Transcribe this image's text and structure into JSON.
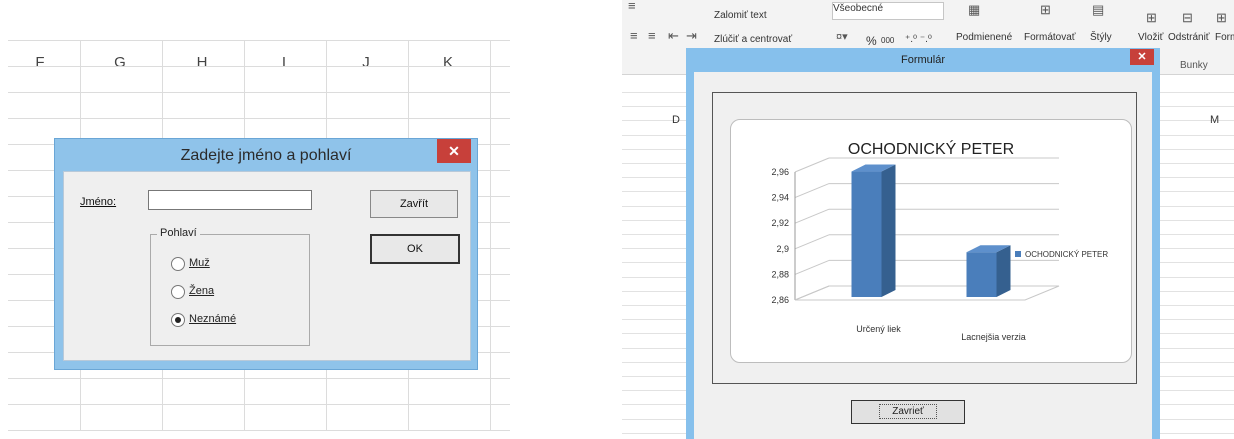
{
  "left": {
    "columns": [
      "F",
      "G",
      "H",
      "I",
      "J",
      "K"
    ],
    "dialog": {
      "title": "Zadejte jméno a pohlaví",
      "close_glyph": "✕",
      "name_label": "Jméno:",
      "name_value": "",
      "close_button": "Zavřít",
      "ok_button": "OK",
      "gender_frame": "Pohlaví",
      "options": [
        "Muž",
        "Žena",
        "Neznámé"
      ],
      "selected_option": "Neznámé"
    }
  },
  "right": {
    "ribbon": {
      "wrap_text": "Zalomiť text",
      "number_format": "Všeobecné",
      "merge_center": "Zlúčiť a centrovať",
      "percent": "%",
      "thousands": "000",
      "cond_format": "Podmienené",
      "format_as": "Formátovať",
      "styles": "Štýly",
      "insert": "Vložiť",
      "delete": "Odstrániť",
      "format": "Form",
      "cells_group": "Bunky"
    },
    "columns": [
      "D",
      "M"
    ],
    "dialog": {
      "title": "Formulár",
      "close_glyph": "✕",
      "close_button": "Zavrieť"
    }
  },
  "chart_data": {
    "type": "bar",
    "title": "OCHODNICKÝ PETER",
    "categories": [
      "Určený liek",
      "Lacnejšia verzia"
    ],
    "series": [
      {
        "name": "OCHODNICKÝ PETER",
        "values": [
          2.958,
          2.895
        ]
      }
    ],
    "ylim": [
      2.86,
      2.96
    ],
    "yticks": [
      "2,86",
      "2,88",
      "2,9",
      "2,92",
      "2,94",
      "2,96"
    ],
    "legend": "right",
    "color": "#4a7ebb",
    "grid": true
  }
}
